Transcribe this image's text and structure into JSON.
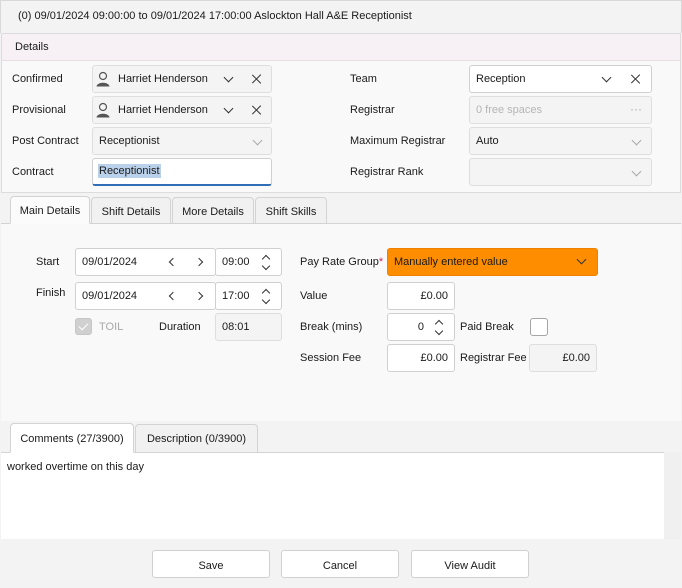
{
  "window": {
    "title": "(0) 09/01/2024 09:00:00 to 09/01/2024 17:00:00 Aslockton Hall A&E Receptionist"
  },
  "details": {
    "header": "Details",
    "confirmed_label": "Confirmed",
    "confirmed_value": "Harriet Henderson",
    "provisional_label": "Provisional",
    "provisional_value": "Harriet Henderson",
    "post_contract_label": "Post Contract",
    "post_contract_value": "Receptionist",
    "contract_label": "Contract",
    "contract_value": "Receptionist",
    "team_label": "Team",
    "team_value": "Reception",
    "registrar_label": "Registrar",
    "registrar_placeholder": "0 free spaces",
    "max_registrar_label": "Maximum Registrar",
    "max_registrar_value": "Auto",
    "registrar_rank_label": "Registrar Rank",
    "registrar_rank_value": ""
  },
  "tabs": {
    "main_details": "Main Details",
    "shift_details": "Shift Details",
    "more_details": "More Details",
    "shift_skills": "Shift Skills"
  },
  "main": {
    "start_label": "Start",
    "start_date": "09/01/2024",
    "start_time": "09:00",
    "finish_label": "Finish",
    "finish_date": "09/01/2024",
    "finish_time": "17:00",
    "toil_label": "TOIL",
    "toil_checked": true,
    "duration_label": "Duration",
    "duration_value": "08:01",
    "pay_rate_group_label": "Pay Rate Group",
    "pay_rate_group_required": "*",
    "pay_rate_group_value": "Manually entered value",
    "value_label": "Value",
    "value_value": "£0.00",
    "break_label": "Break (mins)",
    "break_value": "0",
    "paid_break_label": "Paid Break",
    "paid_break_checked": false,
    "session_fee_label": "Session Fee",
    "session_fee_value": "£0.00",
    "registrar_fee_label": "Registrar Fee",
    "registrar_fee_value": "£0.00"
  },
  "bottom_tabs": {
    "comments": "Comments (27/3900)",
    "description": "Description (0/3900)"
  },
  "comments": {
    "text": "worked overtime on this day"
  },
  "footer": {
    "save": "Save",
    "cancel": "Cancel",
    "view_audit": "View Audit"
  },
  "colors": {
    "accent_orange": "#fe8d00",
    "focus_blue": "#2f6db5",
    "header_tint": "#f7f0f5"
  },
  "icons": {
    "person": "person-icon",
    "dropdown": "chevron-down-icon",
    "clear": "close-icon",
    "ellipsis": "ellipsis-icon",
    "prev": "chevron-left-icon",
    "next": "chevron-right-icon",
    "spin_up": "spin-up-icon",
    "spin_down": "spin-down-icon",
    "check": "check-icon"
  }
}
